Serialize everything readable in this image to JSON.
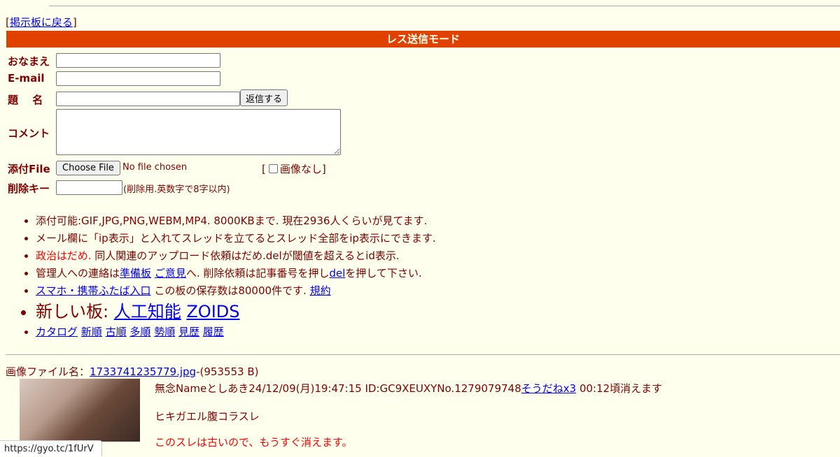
{
  "nav": {
    "back_open": "[",
    "back_link": "掲示板に戻る",
    "back_close": "]"
  },
  "mode_title": "レス送信モード",
  "form": {
    "name_label": "おなまえ",
    "email_label": "E-mail",
    "subject_label": "題　 名",
    "submit_label": "返信する",
    "comment_label": "コメント",
    "file_label": "添付File",
    "choose_file_label": "Choose File",
    "file_status": "No file chosen",
    "noimage_open": "[",
    "noimage_label": "画像なし]",
    "delkey_label": "削除キー",
    "delkey_note": "(削除用.英数字で8字以内)"
  },
  "notes": {
    "line1": "添付可能:GIF,JPG,PNG,WEBM,MP4. 8000KBまで. 現在2936人くらいが見てます.",
    "line2": "メール欄に「ip表示」と入れてスレッドを立てるとスレッド全部をip表示にできます.",
    "line3_red": "政治はだめ.",
    "line3_rest": " 同人関連のアップロード依頼はだめ.delが閾値を超えるとid表示.",
    "line4_a": "管理人への連絡は",
    "line4_link1": "準備板",
    "line4_link2": "ご意見",
    "line4_b": "へ. 削除依頼は記事番号を押し",
    "line4_link3": "del",
    "line4_c": "を押して下さい.",
    "line5_link1": "スマホ・携帯ふたば入口",
    "line5_b": " この板の保存数は80000件です. ",
    "line5_link2": "規約",
    "line6_label": "新しい板: ",
    "line6_link1": "人工知能",
    "line6_link2": "ZOIDS",
    "catalog_links": [
      "カタログ",
      "新順",
      "古順",
      "多順",
      "勢順",
      "見歴",
      "履歴"
    ]
  },
  "post": {
    "file_prefix": "画像ファイル名：",
    "file_name": "1733741235779.jpg",
    "file_size": "-(953553 B)",
    "info_text": "無念Nameとしあき24/12/09(月)19:47:15 ID:GC9XEUXYNo.1279079748",
    "soudane_link": "そうだねx3",
    "expire_text": " 00:12頃消えます",
    "body_line1": "ヒキガエル腹コラスレ",
    "body_line2": "このスレは古いので、もうすぐ消えます。"
  },
  "status_url": "https://gyo.tc/1fUrV"
}
